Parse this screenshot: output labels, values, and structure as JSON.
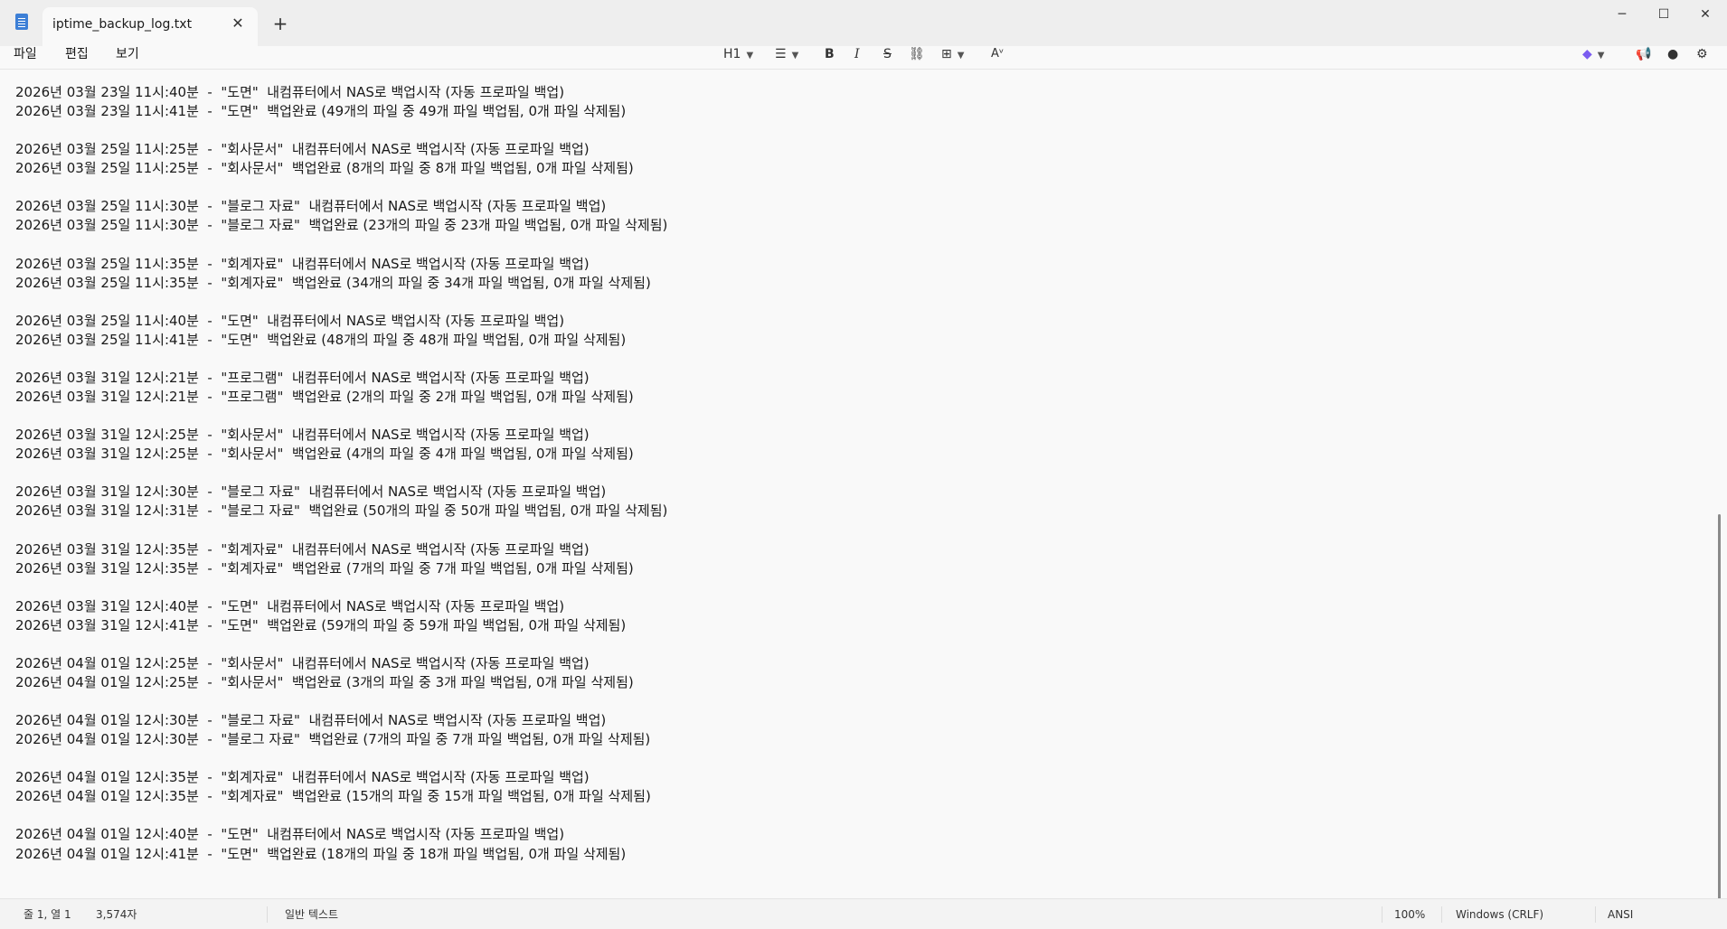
{
  "tab": {
    "title": "iptime_backup_log.txt"
  },
  "menu": {
    "file": "파일",
    "edit": "편집",
    "view": "보기"
  },
  "toolbar": {
    "heading": "H1"
  },
  "lines": [
    "2026년 03월 23일 11시:40분  -  \"도면\"  내컴퓨터에서 NAS로 백업시작 (자동 프로파일 백업)",
    "2026년 03월 23일 11시:41분  -  \"도면\"  백업완료 (49개의 파일 중 49개 파일 백업됨, 0개 파일 삭제됨)",
    "",
    "2026년 03월 25일 11시:25분  -  \"회사문서\"  내컴퓨터에서 NAS로 백업시작 (자동 프로파일 백업)",
    "2026년 03월 25일 11시:25분  -  \"회사문서\"  백업완료 (8개의 파일 중 8개 파일 백업됨, 0개 파일 삭제됨)",
    "",
    "2026년 03월 25일 11시:30분  -  \"블로그 자료\"  내컴퓨터에서 NAS로 백업시작 (자동 프로파일 백업)",
    "2026년 03월 25일 11시:30분  -  \"블로그 자료\"  백업완료 (23개의 파일 중 23개 파일 백업됨, 0개 파일 삭제됨)",
    "",
    "2026년 03월 25일 11시:35분  -  \"회계자료\"  내컴퓨터에서 NAS로 백업시작 (자동 프로파일 백업)",
    "2026년 03월 25일 11시:35분  -  \"회계자료\"  백업완료 (34개의 파일 중 34개 파일 백업됨, 0개 파일 삭제됨)",
    "",
    "2026년 03월 25일 11시:40분  -  \"도면\"  내컴퓨터에서 NAS로 백업시작 (자동 프로파일 백업)",
    "2026년 03월 25일 11시:41분  -  \"도면\"  백업완료 (48개의 파일 중 48개 파일 백업됨, 0개 파일 삭제됨)",
    "",
    "2026년 03월 31일 12시:21분  -  \"프로그램\"  내컴퓨터에서 NAS로 백업시작 (자동 프로파일 백업)",
    "2026년 03월 31일 12시:21분  -  \"프로그램\"  백업완료 (2개의 파일 중 2개 파일 백업됨, 0개 파일 삭제됨)",
    "",
    "2026년 03월 31일 12시:25분  -  \"회사문서\"  내컴퓨터에서 NAS로 백업시작 (자동 프로파일 백업)",
    "2026년 03월 31일 12시:25분  -  \"회사문서\"  백업완료 (4개의 파일 중 4개 파일 백업됨, 0개 파일 삭제됨)",
    "",
    "2026년 03월 31일 12시:30분  -  \"블로그 자료\"  내컴퓨터에서 NAS로 백업시작 (자동 프로파일 백업)",
    "2026년 03월 31일 12시:31분  -  \"블로그 자료\"  백업완료 (50개의 파일 중 50개 파일 백업됨, 0개 파일 삭제됨)",
    "",
    "2026년 03월 31일 12시:35분  -  \"회계자료\"  내컴퓨터에서 NAS로 백업시작 (자동 프로파일 백업)",
    "2026년 03월 31일 12시:35분  -  \"회계자료\"  백업완료 (7개의 파일 중 7개 파일 백업됨, 0개 파일 삭제됨)",
    "",
    "2026년 03월 31일 12시:40분  -  \"도면\"  내컴퓨터에서 NAS로 백업시작 (자동 프로파일 백업)",
    "2026년 03월 31일 12시:41분  -  \"도면\"  백업완료 (59개의 파일 중 59개 파일 백업됨, 0개 파일 삭제됨)",
    "",
    "2026년 04월 01일 12시:25분  -  \"회사문서\"  내컴퓨터에서 NAS로 백업시작 (자동 프로파일 백업)",
    "2026년 04월 01일 12시:25분  -  \"회사문서\"  백업완료 (3개의 파일 중 3개 파일 백업됨, 0개 파일 삭제됨)",
    "",
    "2026년 04월 01일 12시:30분  -  \"블로그 자료\"  내컴퓨터에서 NAS로 백업시작 (자동 프로파일 백업)",
    "2026년 04월 01일 12시:30분  -  \"블로그 자료\"  백업완료 (7개의 파일 중 7개 파일 백업됨, 0개 파일 삭제됨)",
    "",
    "2026년 04월 01일 12시:35분  -  \"회계자료\"  내컴퓨터에서 NAS로 백업시작 (자동 프로파일 백업)",
    "2026년 04월 01일 12시:35분  -  \"회계자료\"  백업완료 (15개의 파일 중 15개 파일 백업됨, 0개 파일 삭제됨)",
    "",
    "2026년 04월 01일 12시:40분  -  \"도면\"  내컴퓨터에서 NAS로 백업시작 (자동 프로파일 백업)",
    "2026년 04월 01일 12시:41분  -  \"도면\"  백업완료 (18개의 파일 중 18개 파일 백업됨, 0개 파일 삭제됨)"
  ],
  "status": {
    "position": "줄 1, 열 1",
    "char_count": "3,574자",
    "format": "일반 텍스트",
    "zoom": "100%",
    "line_ending": "Windows (CRLF)",
    "encoding": "ANSI"
  },
  "colors": {
    "copilot_accent": "#7b5cf0",
    "app_icon": "#3d7fd6"
  }
}
